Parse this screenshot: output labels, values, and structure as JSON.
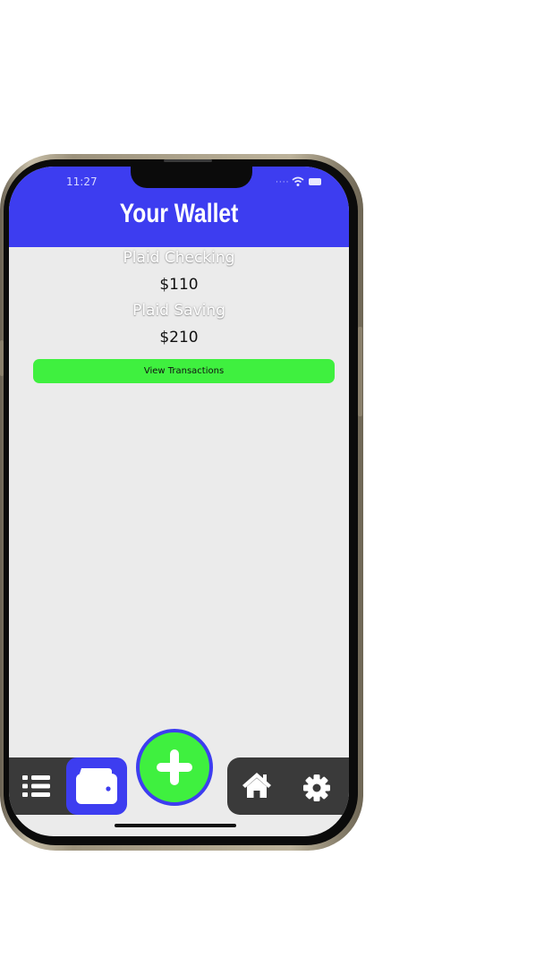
{
  "status_bar": {
    "time": "11:27"
  },
  "header": {
    "title": "Your Wallet"
  },
  "accounts": [
    {
      "name": "Plaid Checking",
      "balance": "$110"
    },
    {
      "name": "Plaid Saving",
      "balance": "$210"
    }
  ],
  "actions": {
    "view_transactions_label": "View Transactions"
  },
  "nav": {
    "items": [
      "list-icon",
      "wallet-icon",
      "add-icon",
      "home-icon",
      "settings-icon"
    ],
    "active": "wallet-icon"
  },
  "colors": {
    "header_bg": "#3d3df0",
    "accent_green": "#3ff03f",
    "nav_bg": "#3a3a3a",
    "screen_bg": "#ebebeb"
  }
}
